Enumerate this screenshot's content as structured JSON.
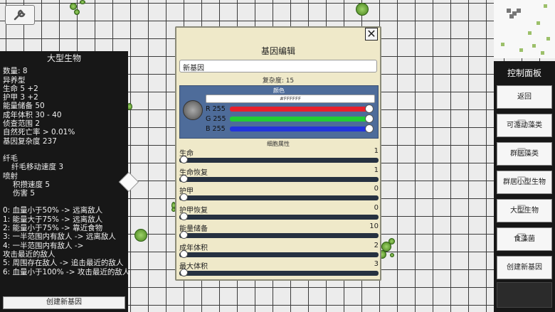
{
  "left_panel": {
    "title": "大型生物",
    "lines_a": [
      "数量: 8",
      "异养型",
      "生命 5 +2",
      "护甲 3 +2",
      "能量储备 50",
      "成年体积 30 - 40",
      "侦查范围 2",
      "自然死亡率 > 0.01%",
      "基因复杂度 237"
    ],
    "flagella": "纤毛",
    "flagella_speed": "纤毛移动速度 3",
    "spray": "喷射",
    "spray_speed": "积攒速度 5",
    "spray_damage": "伤害 5",
    "rules": [
      "0: 血量小于50% -> 远离敌人",
      "1: 能量大于75% -> 远离敌人",
      "2: 能量小于75% -> 靠近食物",
      "3: 一半范围内有敌人 -> 远离敌人",
      "4: 一半范围内有敌人 ->",
      "攻击最近的敌人",
      "5: 周围存在敌人 -> 追击最近的敌人",
      "6: 血量小于100% -> 攻击最近的敌人"
    ],
    "create_button": "创建新基因"
  },
  "editor": {
    "title": "基因编辑",
    "close_label": "✕",
    "name_value": "新基因",
    "complexity": "复杂度: 15",
    "color_label": "颜色",
    "hex_value": "#FFFFFF",
    "rgb": [
      {
        "label": "R 255",
        "value": 255,
        "color": "#e8202c"
      },
      {
        "label": "G 255",
        "value": 255,
        "color": "#22cc33"
      },
      {
        "label": "B 255",
        "value": 255,
        "color": "#2233dd"
      }
    ],
    "attr_heading": "细胞属性",
    "attributes": [
      {
        "name": "生命",
        "value": "1"
      },
      {
        "name": "生命恢复",
        "value": "1"
      },
      {
        "name": "护甲",
        "value": "0"
      },
      {
        "name": "护甲恢复",
        "value": "0"
      },
      {
        "name": "能量储备",
        "value": "10"
      },
      {
        "name": "成年体积",
        "value": "2"
      },
      {
        "name": "最大体积",
        "value": "3"
      }
    ]
  },
  "control_panel": {
    "title": "控制面板",
    "buttons": [
      "返回",
      "可游动藻类",
      "群居藻类",
      "群居小型生物",
      "大型生物",
      "食藻菌",
      "创建新基因"
    ]
  },
  "icons": {
    "tool": "wrench-icon"
  }
}
